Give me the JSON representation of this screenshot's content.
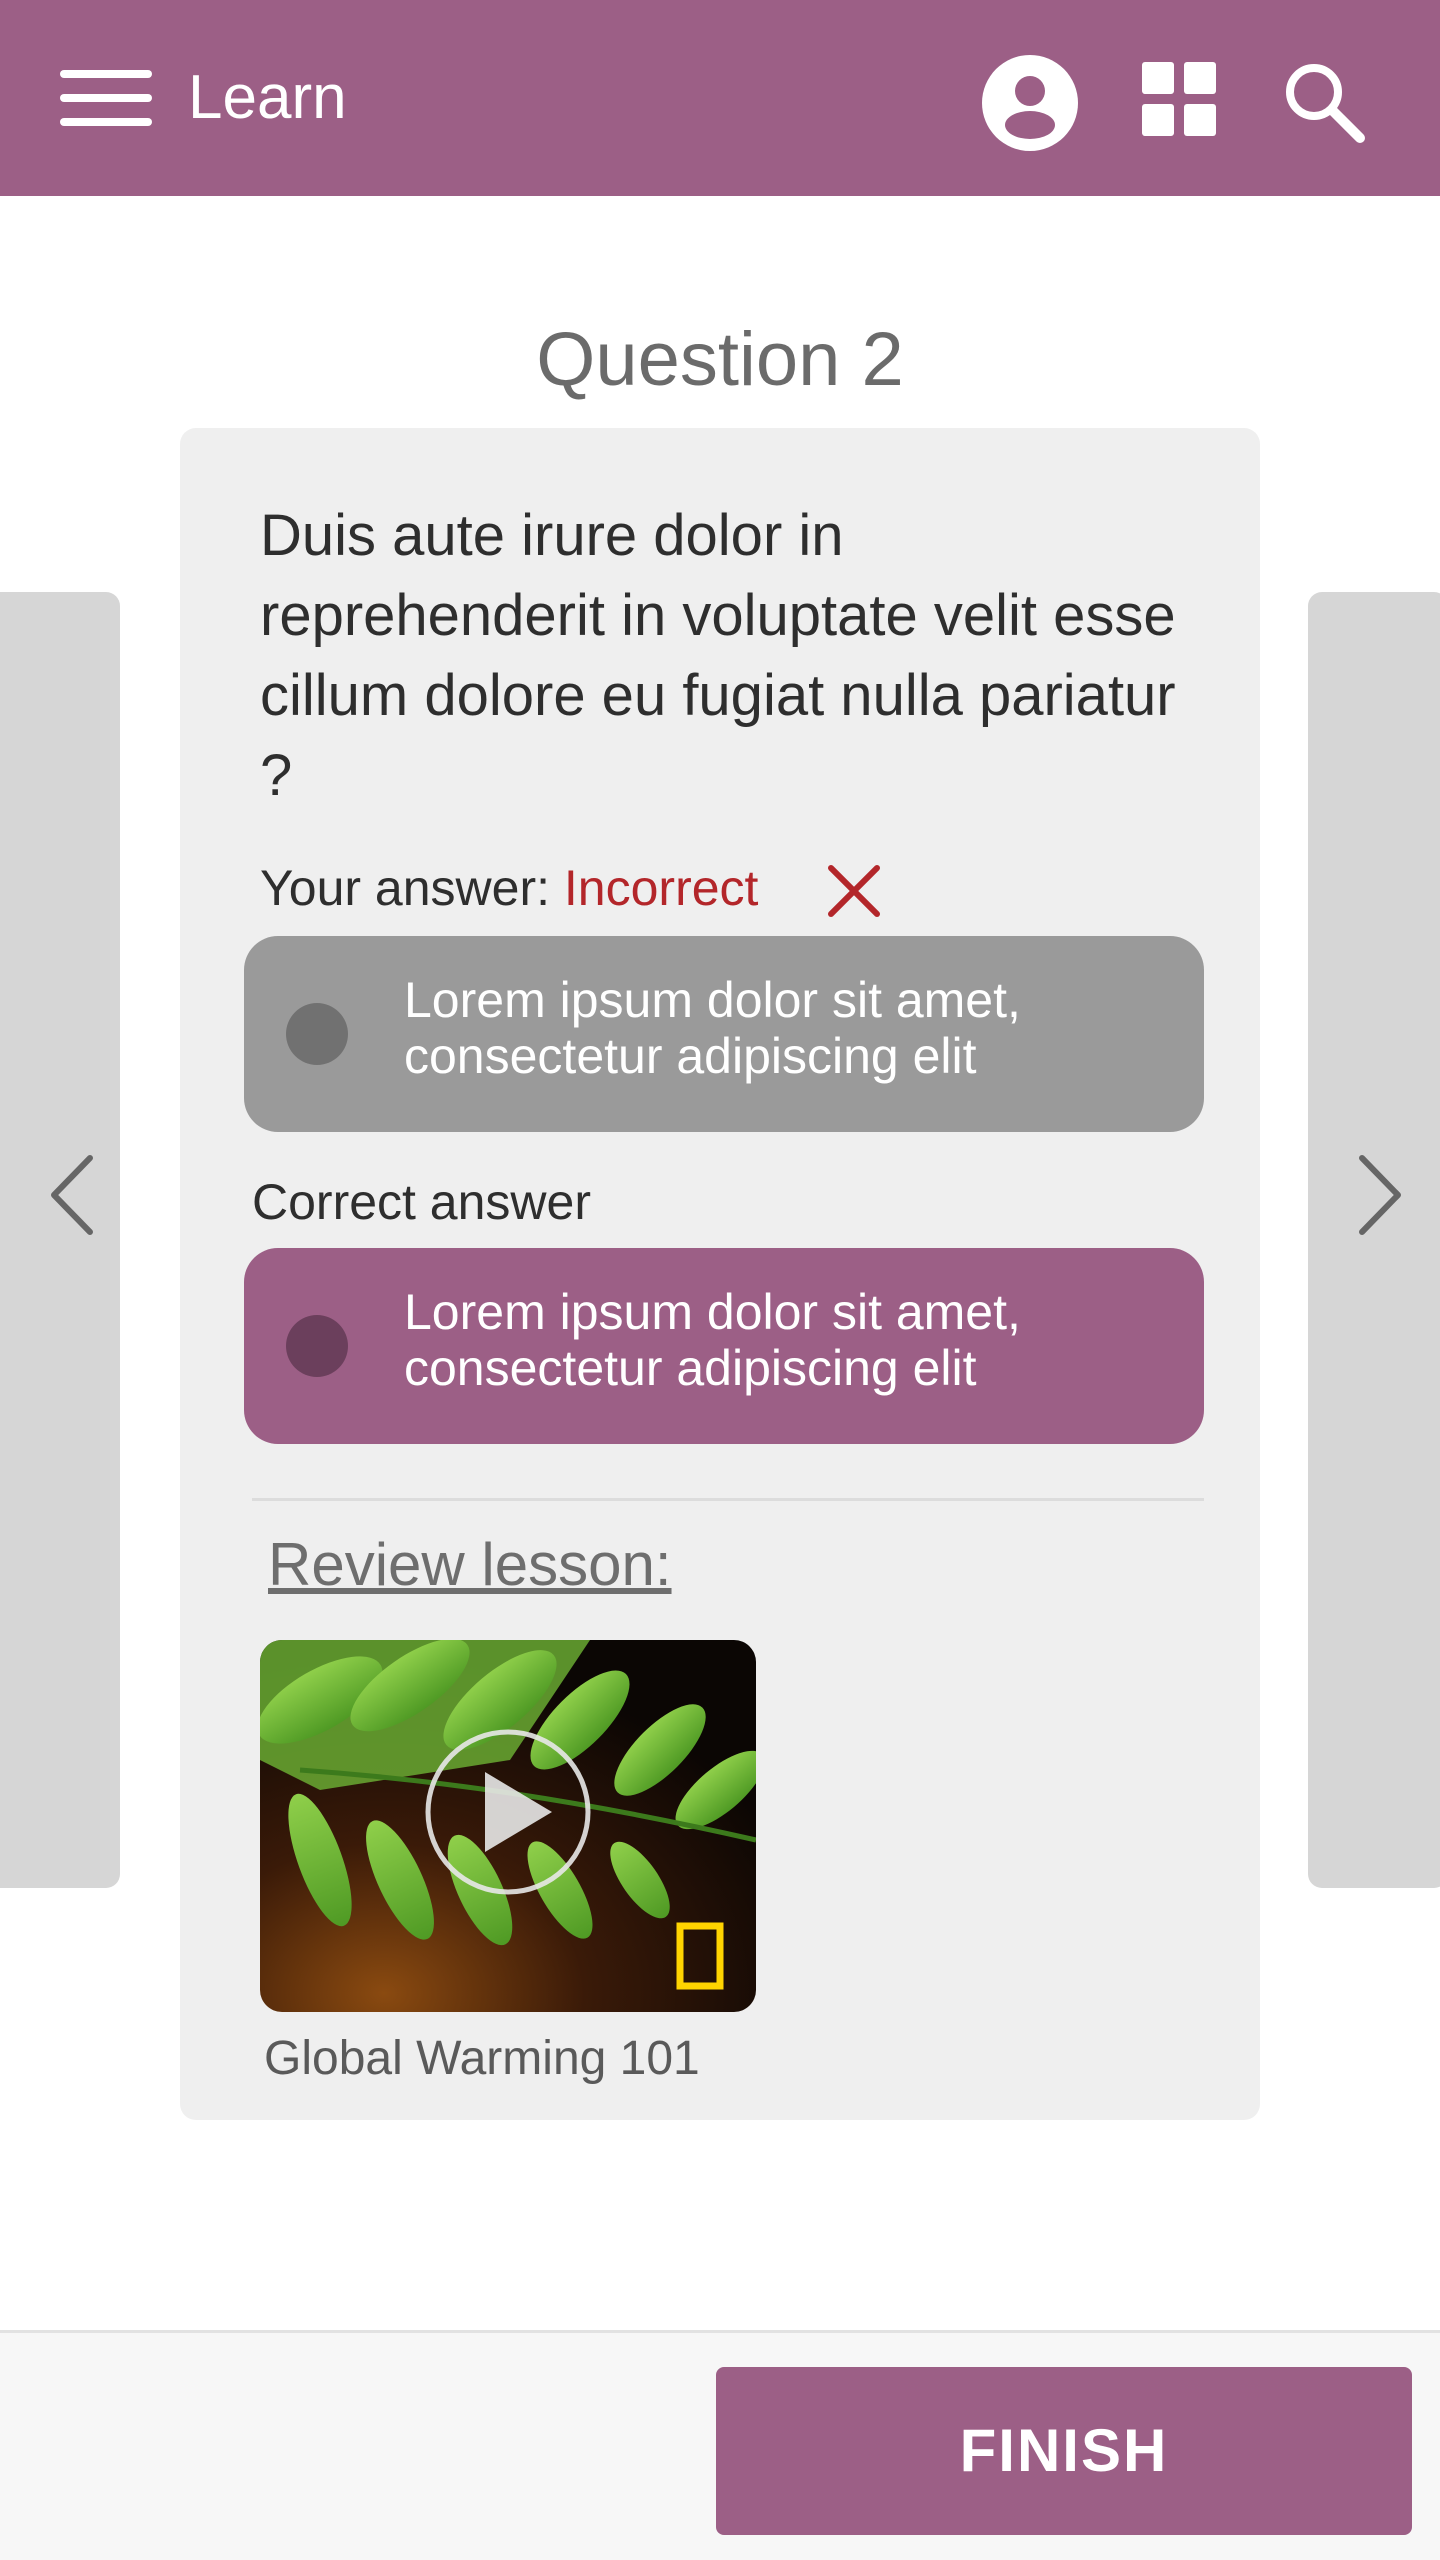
{
  "header": {
    "title": "Learn",
    "icons": [
      "menu-icon",
      "profile-icon",
      "grid-icon",
      "search-icon"
    ],
    "background_color": "#9c5f86"
  },
  "question": {
    "heading": "Question 2",
    "text": "Duis aute irure dolor in reprehenderit in voluptate velit esse cillum dolore eu fugiat nulla pariatur ?"
  },
  "your_answer": {
    "label": "Your answer:",
    "status": "Incorrect",
    "status_color": "#b3262a",
    "answer_text": "Lorem ipsum dolor sit amet, consectetur adipiscing elit"
  },
  "correct_answer": {
    "label": "Correct answer",
    "answer_text": "Lorem ipsum dolor sit amet, consectetur adipiscing elit"
  },
  "review": {
    "label": "Review lesson:",
    "lesson_title": "Global Warming 101",
    "thumbnail_icons": [
      "play-icon",
      "national-geographic-logo"
    ]
  },
  "navigation": {
    "prev_icon": "chevron-left-icon",
    "next_icon": "chevron-right-icon"
  },
  "footer": {
    "finish_label": "FINISH"
  }
}
